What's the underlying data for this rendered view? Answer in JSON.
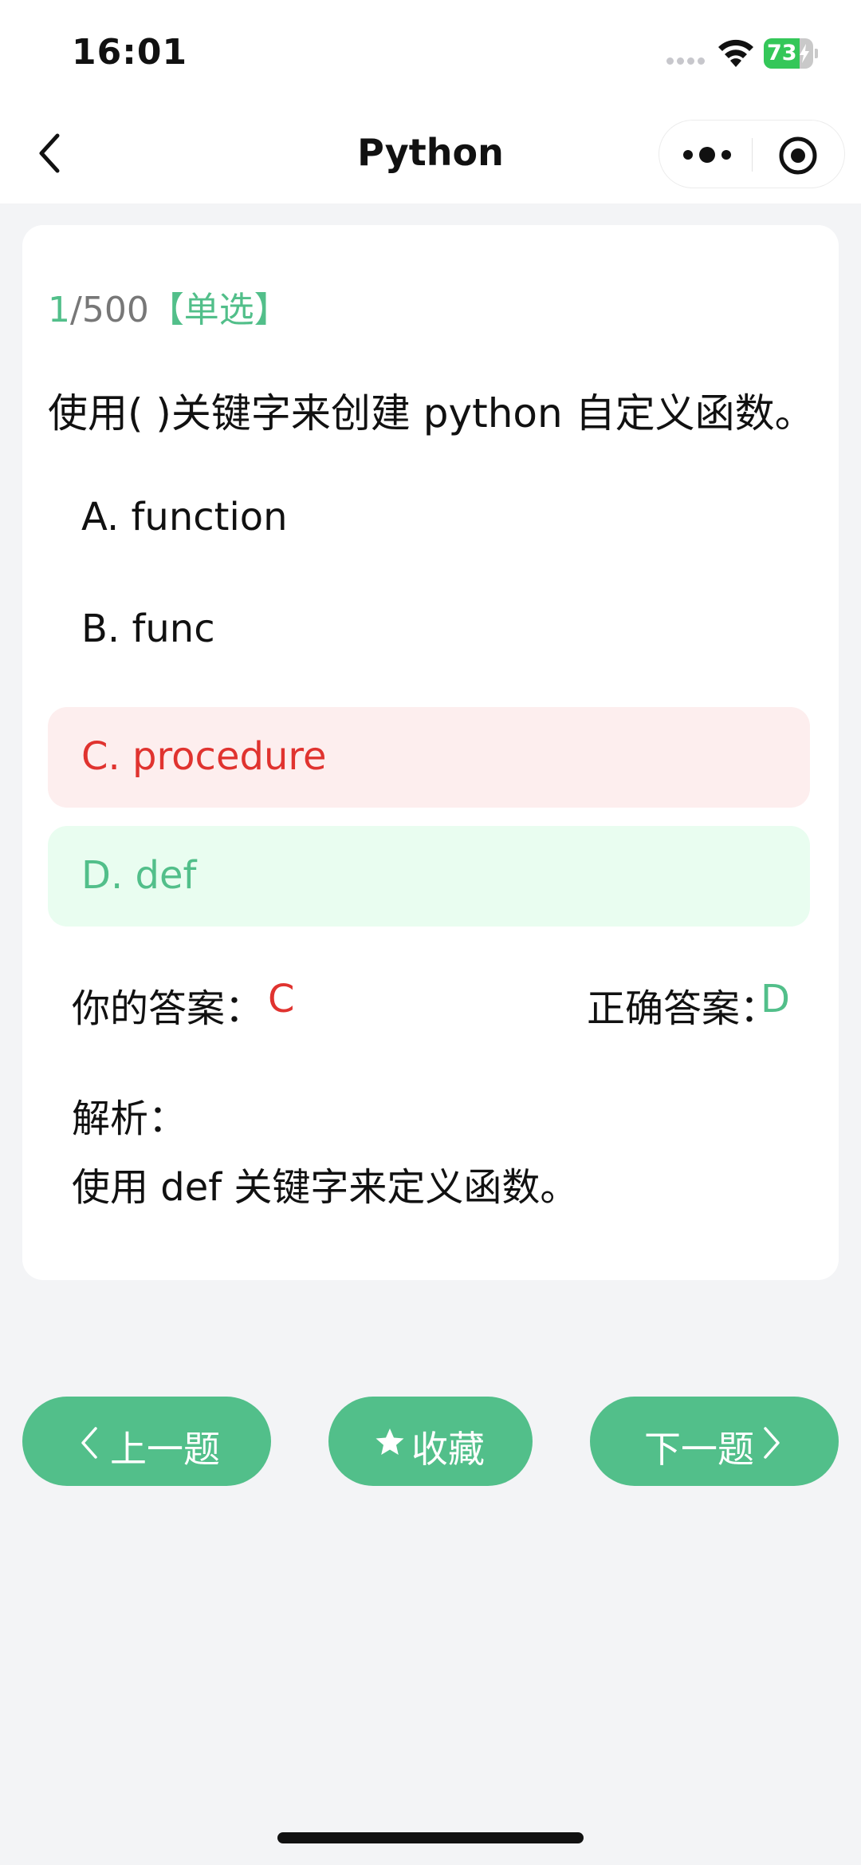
{
  "status_bar": {
    "time": "16:01",
    "battery": "73",
    "battery_level": 0.73
  },
  "nav": {
    "title": "Python"
  },
  "quiz": {
    "current": "1",
    "total": "/500",
    "type": "【单选】",
    "question": "使用( )关键字来创建 python 自定义函数。",
    "options": [
      {
        "label": "A. function",
        "state": "normal"
      },
      {
        "label": "B. func",
        "state": "normal"
      },
      {
        "label": "C. procedure",
        "state": "wrong"
      },
      {
        "label": "D. def",
        "state": "correct"
      }
    ],
    "your_answer_label": "你的答案：",
    "your_answer": "C",
    "correct_answer_label": "正确答案：",
    "correct_answer": "D",
    "analysis_title": "解析：",
    "analysis_text": "使用 def 关键字来定义函数。"
  },
  "buttons": {
    "prev": "上一题",
    "favorite": "收藏",
    "next": "下一题"
  },
  "colors": {
    "accent": "#52bf8a",
    "wrong": "#e0332f",
    "wrong_bg": "#fdeeee",
    "correct_bg": "#e9fdf0",
    "background": "#f3f4f6"
  },
  "icons": [
    "back-icon",
    "more-icon",
    "close-mini-program-icon",
    "chevron-left-icon",
    "star-icon",
    "chevron-right-icon",
    "wifi-icon",
    "battery-icon",
    "charging-bolt-icon"
  ]
}
